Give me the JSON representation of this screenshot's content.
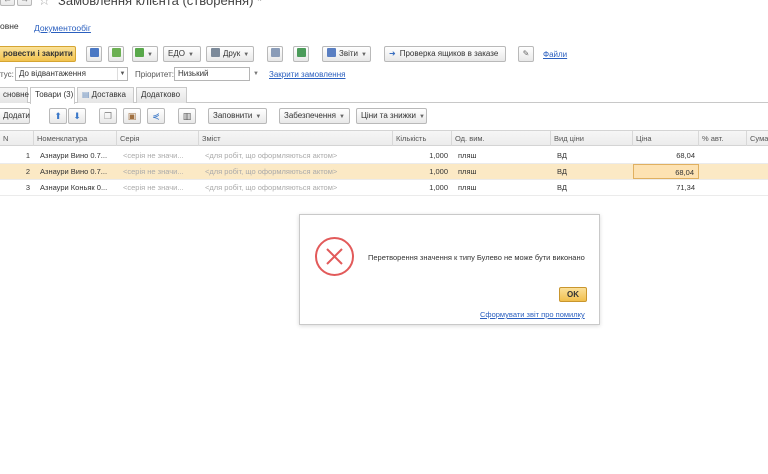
{
  "window": {
    "title": "Замовлення клієнта (створення) *",
    "back_icon": "arrow-left-icon",
    "forward_icon": "arrow-right-icon",
    "favorite_icon": "star-icon"
  },
  "top_tabs": {
    "main": "овне",
    "documents": "Документообіг"
  },
  "toolbar": {
    "post_and_close": "ровести і закрити",
    "edo": "ЕДО",
    "print": "Друк",
    "reports": "Звіти",
    "check_boxes": "Проверка ящиков в заказе",
    "files": "Файли"
  },
  "fields": {
    "status_label": "тус:",
    "status_value": "До відвантаження",
    "priority_label": "Пріоритет:",
    "priority_value": "Низький",
    "close_order_link": "Закрити замовлення"
  },
  "sub_tabs": [
    "сновне",
    "Товари (3)",
    "Доставка",
    "Додатково"
  ],
  "table_toolbar": {
    "add": "Додати",
    "fill": "Заповнити",
    "supply": "Забезпечення",
    "prices_discounts": "Ціни та знижки"
  },
  "table": {
    "columns": [
      "N",
      "Номенклатура",
      "Серія",
      "Зміст",
      "Кількість",
      "Од. вим.",
      "Вид ціни",
      "Ціна",
      "% авт.",
      "Сума"
    ],
    "rows": [
      {
        "n": "1",
        "item": "Азнаури Вино 0.7...",
        "series": "<серія не значи...",
        "content": "<для робіт, що оформляються актом>",
        "qty": "1,000",
        "unit": "пляш",
        "price_type": "ВД",
        "price": "68,04",
        "selected": false
      },
      {
        "n": "2",
        "item": "Азнаури Вино 0.7...",
        "series": "<серія не значи...",
        "content": "<для робіт, що оформляються актом>",
        "qty": "1,000",
        "unit": "пляш",
        "price_type": "ВД",
        "price": "68,04",
        "selected": true
      },
      {
        "n": "3",
        "item": "Азнаури Коньяк 0...",
        "series": "<серія не значи...",
        "content": "<для робіт, що оформляються актом>",
        "qty": "1,000",
        "unit": "пляш",
        "price_type": "ВД",
        "price": "71,34",
        "selected": false
      }
    ]
  },
  "dialog": {
    "message": "Перетворення значення к типу Булево не може бути виконано",
    "ok": "OK",
    "report_link": "Сформувати звіт про помилку",
    "icon": "error-x-icon"
  }
}
